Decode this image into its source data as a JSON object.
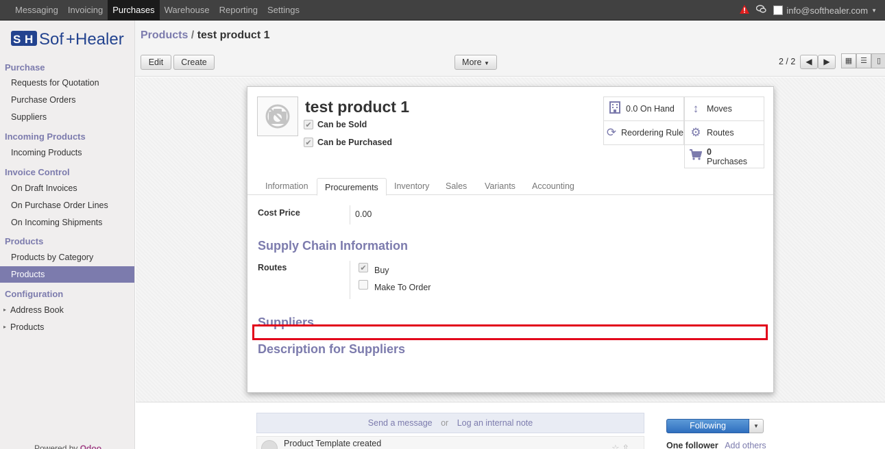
{
  "topbar": {
    "menu": [
      "Messaging",
      "Invoicing",
      "Purchases",
      "Warehouse",
      "Reporting",
      "Settings"
    ],
    "active_index": 2,
    "user": "info@softhealer.com"
  },
  "sidebar": {
    "logo_text": "SofHealer",
    "sections": [
      {
        "title": "Purchase",
        "items": [
          "Requests for Quotation",
          "Purchase Orders",
          "Suppliers"
        ]
      },
      {
        "title": "Incoming Products",
        "items": [
          "Incoming Products"
        ]
      },
      {
        "title": "Invoice Control",
        "items": [
          "On Draft Invoices",
          "On Purchase Order Lines",
          "On Incoming Shipments"
        ]
      },
      {
        "title": "Products",
        "items": [
          "Products by Category",
          "Products"
        ]
      },
      {
        "title": "Configuration",
        "items": [
          "Address Book",
          "Products"
        ]
      }
    ],
    "powered_by": "Powered by",
    "powered_brand": "Odoo"
  },
  "control": {
    "breadcrumb_parent": "Products",
    "breadcrumb_sep": "/",
    "breadcrumb_current": "test product 1",
    "edit_label": "Edit",
    "create_label": "Create",
    "more_label": "More",
    "pager": "2 / 2"
  },
  "product": {
    "name": "test product 1",
    "can_be_sold": "Can be Sold",
    "can_be_purchased": "Can be Purchased"
  },
  "stats": {
    "on_hand": "0.0 On Hand",
    "moves": "Moves",
    "reordering": "Reordering Rule",
    "routes": "Routes",
    "purchases_count": "0",
    "purchases_label": "Purchases"
  },
  "tabs": [
    "Information",
    "Procurements",
    "Inventory",
    "Sales",
    "Variants",
    "Accounting"
  ],
  "active_tab": 1,
  "procurements": {
    "cost_price_label": "Cost Price",
    "cost_price_value": "0.00",
    "supply_chain_heading": "Supply Chain Information",
    "routes_label": "Routes",
    "route_buy": "Buy",
    "route_mto": "Make To Order",
    "suppliers_heading": "Suppliers",
    "desc_heading": "Description for Suppliers"
  },
  "chatter": {
    "send_message": "Send a message",
    "or": "or",
    "log_note": "Log an internal note",
    "message": "Product Template created",
    "following": "Following",
    "followers": "One follower",
    "add_others": "Add others"
  },
  "colors": {
    "accent": "#7c7bad",
    "highlight": "#e2001a",
    "topbar": "#414141"
  }
}
